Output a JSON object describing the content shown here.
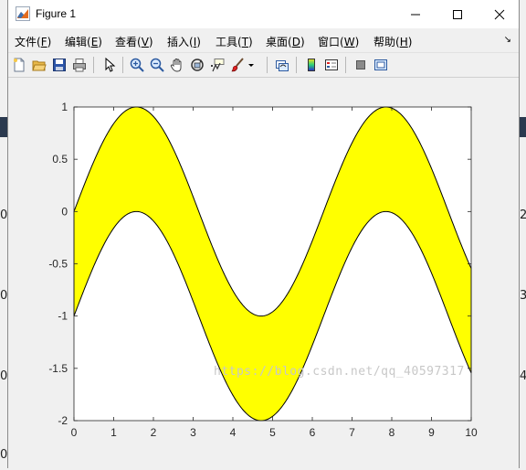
{
  "window": {
    "title": "Figure 1"
  },
  "menu": [
    {
      "label": "文件(",
      "key": "F",
      "tail": ")"
    },
    {
      "label": "编辑(",
      "key": "E",
      "tail": ")"
    },
    {
      "label": "查看(",
      "key": "V",
      "tail": ")"
    },
    {
      "label": "插入(",
      "key": "I",
      "tail": ")"
    },
    {
      "label": "工具(",
      "key": "T",
      "tail": ")"
    },
    {
      "label": "桌面(",
      "key": "D",
      "tail": ")"
    },
    {
      "label": "窗口(",
      "key": "W",
      "tail": ")"
    },
    {
      "label": "帮助(",
      "key": "H",
      "tail": ")"
    }
  ],
  "toolbar": [
    "new-figure-icon",
    "open-file-icon",
    "save-icon",
    "print-icon",
    "select-arrow-icon",
    "zoom-in-icon",
    "zoom-out-icon",
    "pan-hand-icon",
    "rotate-3d-icon",
    "data-cursor-icon",
    "brush-icon",
    "link-plot-icon",
    "colorbar-icon",
    "legend-icon",
    "hide-plot-tools-icon",
    "show-plot-tools-icon"
  ],
  "chart_data": {
    "type": "area",
    "title": "",
    "xlabel": "",
    "ylabel": "",
    "xlim": [
      0,
      10
    ],
    "ylim": [
      -2,
      1
    ],
    "xticks": [
      "0",
      "1",
      "2",
      "3",
      "4",
      "5",
      "6",
      "7",
      "8",
      "9",
      "10"
    ],
    "yticks": [
      "1",
      "0.5",
      "0",
      "-0.5",
      "-1",
      "-1.5",
      "-2"
    ],
    "fill_color": "#ffff00",
    "line_color": "#000000",
    "series": [
      {
        "function": "sin(x)",
        "x_range": [
          0,
          10
        ]
      },
      {
        "function": "sin(x) - 1",
        "x_range": [
          0,
          10
        ]
      }
    ],
    "fill_between": true,
    "grid": false
  },
  "watermark": "https://blog.csdn.net/qq_40597317",
  "background_fragments": {
    "right": [
      "2",
      "3",
      "4"
    ],
    "left": [
      "0",
      "0",
      "0",
      "0"
    ]
  }
}
